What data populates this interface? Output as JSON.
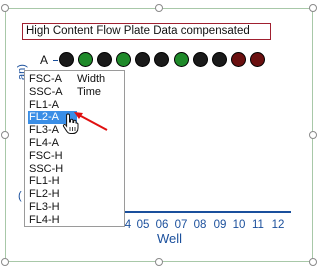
{
  "title": "High Content Flow Plate Data compensated",
  "row_label": "A",
  "well_colors": {
    "black": "#1a1a1a",
    "green": "#1f8a2a",
    "dark_red": "#6a1010"
  },
  "wells": [
    {
      "color": "black"
    },
    {
      "color": "green"
    },
    {
      "color": "black"
    },
    {
      "color": "green"
    },
    {
      "color": "black"
    },
    {
      "color": "black"
    },
    {
      "color": "green"
    },
    {
      "color": "black"
    },
    {
      "color": "black"
    },
    {
      "color": "dark_red"
    },
    {
      "color": "dark_red"
    }
  ],
  "y_axis_title_fragment": "an)",
  "y_axis_title_fragment_lower": "(",
  "x_axis": {
    "title": "Well",
    "labels": [
      "4",
      "05",
      "06",
      "07",
      "08",
      "09",
      "10",
      "11",
      "12"
    ]
  },
  "dropdown": {
    "column1": [
      "FSC-A",
      "SSC-A",
      "FL1-A",
      "FL2-A",
      "FL3-A",
      "FL4-A",
      "FSC-H",
      "SSC-H",
      "FL1-H",
      "FL2-H",
      "FL3-H",
      "FL4-H"
    ],
    "column2": [
      "Width",
      "Time"
    ],
    "selected": "FL2-A"
  },
  "colors": {
    "accent": "#3a8ee6",
    "axis": "#1a4f9c",
    "title_border": "#a02030",
    "selection_frame": "#a8c8a8",
    "pointer_arrow": "#e01010"
  }
}
